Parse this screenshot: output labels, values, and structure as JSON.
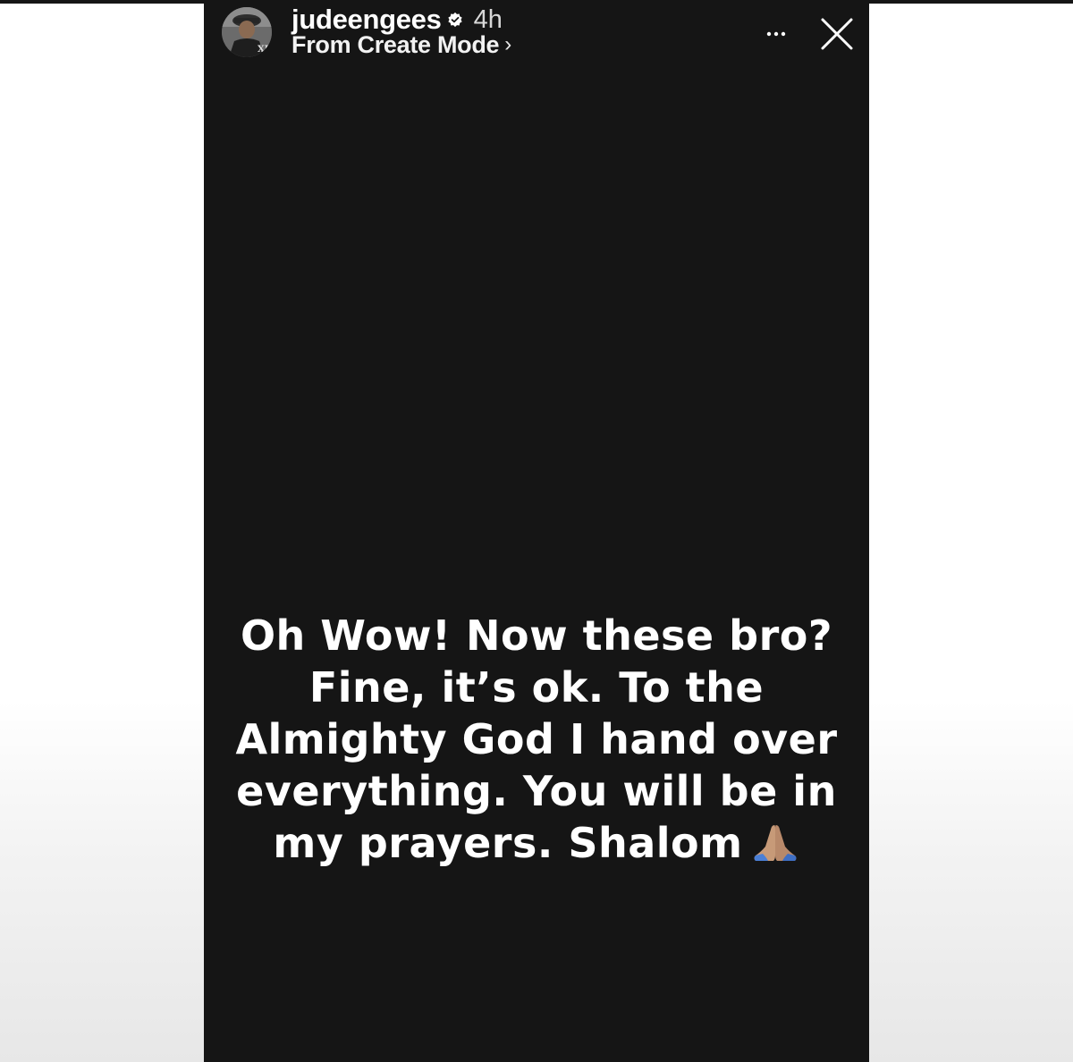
{
  "story": {
    "username": "judeengees",
    "time_ago": "4h",
    "subtitle": "From Create Mode",
    "chevron": "›",
    "text": "Oh Wow! Now these bro?\nFine, it’s ok. To the\nAlmighty God I hand over\neverything. You will be in\nmy prayers. Shalom",
    "emoji": "folded-hands-emoji",
    "background_color": "#151515",
    "text_color": "#ffffff"
  },
  "icons": {
    "verified": "verified-badge-icon",
    "more": "more-horizontal-icon",
    "close": "close-icon"
  }
}
